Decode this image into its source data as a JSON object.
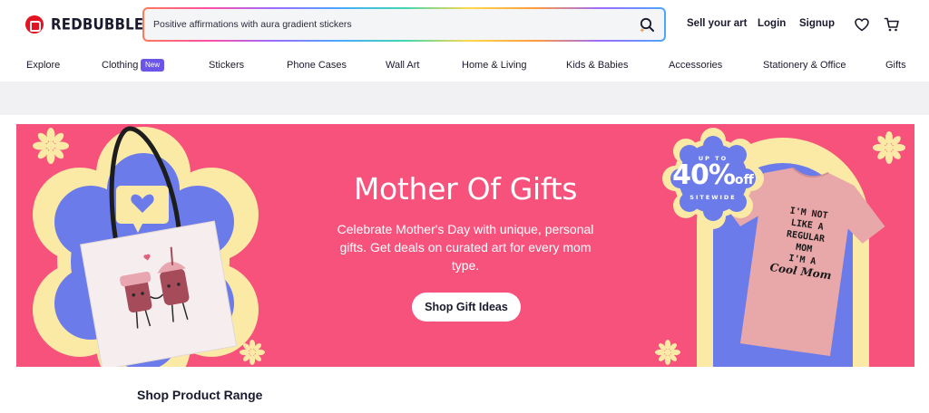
{
  "brand": {
    "name": "REDBUBBLE"
  },
  "search": {
    "value": "Positive affirmations with aura gradient stickers"
  },
  "header": {
    "sell_label": "Sell your art",
    "login_label": "Login",
    "signup_label": "Signup"
  },
  "nav": {
    "items": [
      "Explore",
      "Clothing",
      "Stickers",
      "Phone Cases",
      "Wall Art",
      "Home & Living",
      "Kids & Babies",
      "Accessories",
      "Stationery & Office",
      "Gifts"
    ],
    "new_badge": "New"
  },
  "banner": {
    "title": "Mother Of Gifts",
    "subtitle": "Celebrate Mother's Day with unique, personal gifts. Get deals on curated art for every mom type.",
    "cta_label": "Shop Gift Ideas",
    "promo": {
      "up_to": "UP TO",
      "percent": "40%",
      "off": "off",
      "sitewide": "SITEWIDE"
    },
    "tshirt_text": [
      "I'M NOT",
      "LIKE A",
      "REGULAR",
      "MOM",
      "I'M A",
      "Cool Mom"
    ],
    "colors": {
      "background": "#f6527c",
      "cream": "#fbe9a6",
      "blue": "#6b7bea"
    }
  },
  "section": {
    "title": "Shop Product Range"
  }
}
